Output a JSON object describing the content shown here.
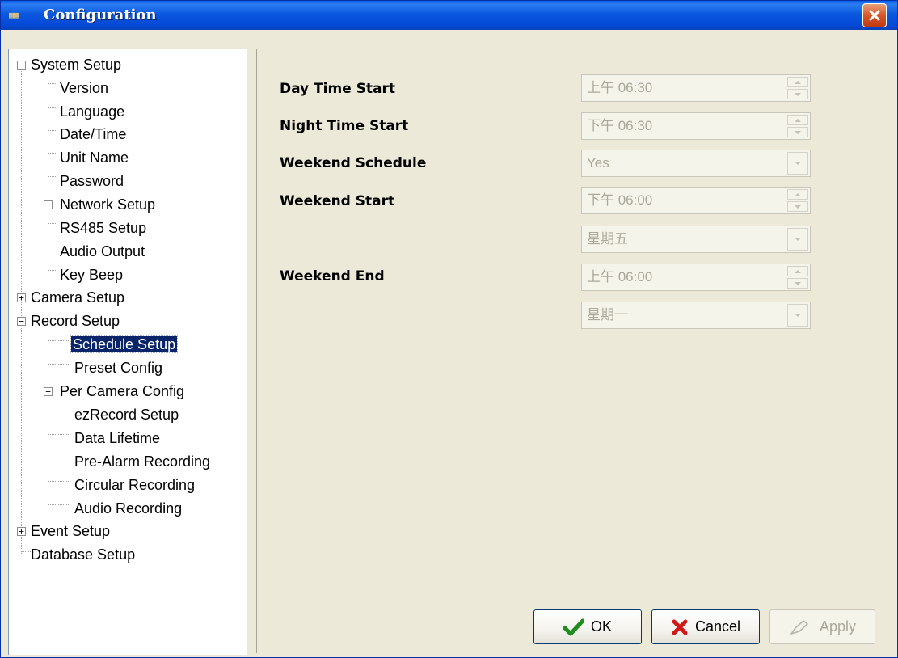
{
  "window": {
    "title": "Configuration",
    "app_icon": "dvr-app-icon",
    "close": "close-icon"
  },
  "tree": {
    "system_setup": "System Setup",
    "version": "Version",
    "language": "Language",
    "date_time": "Date/Time",
    "unit_name": "Unit Name",
    "password": "Password",
    "network_setup": "Network Setup",
    "rs485_setup": "RS485 Setup",
    "audio_output": "Audio Output",
    "key_beep": "Key Beep",
    "camera_setup": "Camera Setup",
    "record_setup": "Record Setup",
    "schedule_setup": "Schedule Setup",
    "preset_config": "Preset Config",
    "per_camera_config": "Per Camera Config",
    "ezrecord_setup": "ezRecord Setup",
    "data_lifetime": "Data Lifetime",
    "pre_alarm_recording": "Pre-Alarm Recording",
    "circular_recording": "Circular Recording",
    "audio_recording": "Audio Recording",
    "event_setup": "Event Setup",
    "database_setup": "Database Setup",
    "selected": "Schedule Setup"
  },
  "form": {
    "day_time_start": {
      "label": "Day Time Start",
      "value": "上午 06:30"
    },
    "night_time_start": {
      "label": "Night Time Start",
      "value": "下午 06:30"
    },
    "weekend_schedule": {
      "label": "Weekend Schedule",
      "value": "Yes"
    },
    "weekend_start": {
      "label": "Weekend Start",
      "time": "下午 06:00",
      "day": "星期五"
    },
    "weekend_end": {
      "label": "Weekend End",
      "time": "上午 06:00",
      "day": "星期一"
    }
  },
  "buttons": {
    "ok": "OK",
    "cancel": "Cancel",
    "apply": "Apply"
  },
  "colors": {
    "titlebar": "#0A5CE4",
    "selection": "#0A246A",
    "dialog_bg": "#ECE9D8",
    "disabled_text": "#ACA899"
  }
}
